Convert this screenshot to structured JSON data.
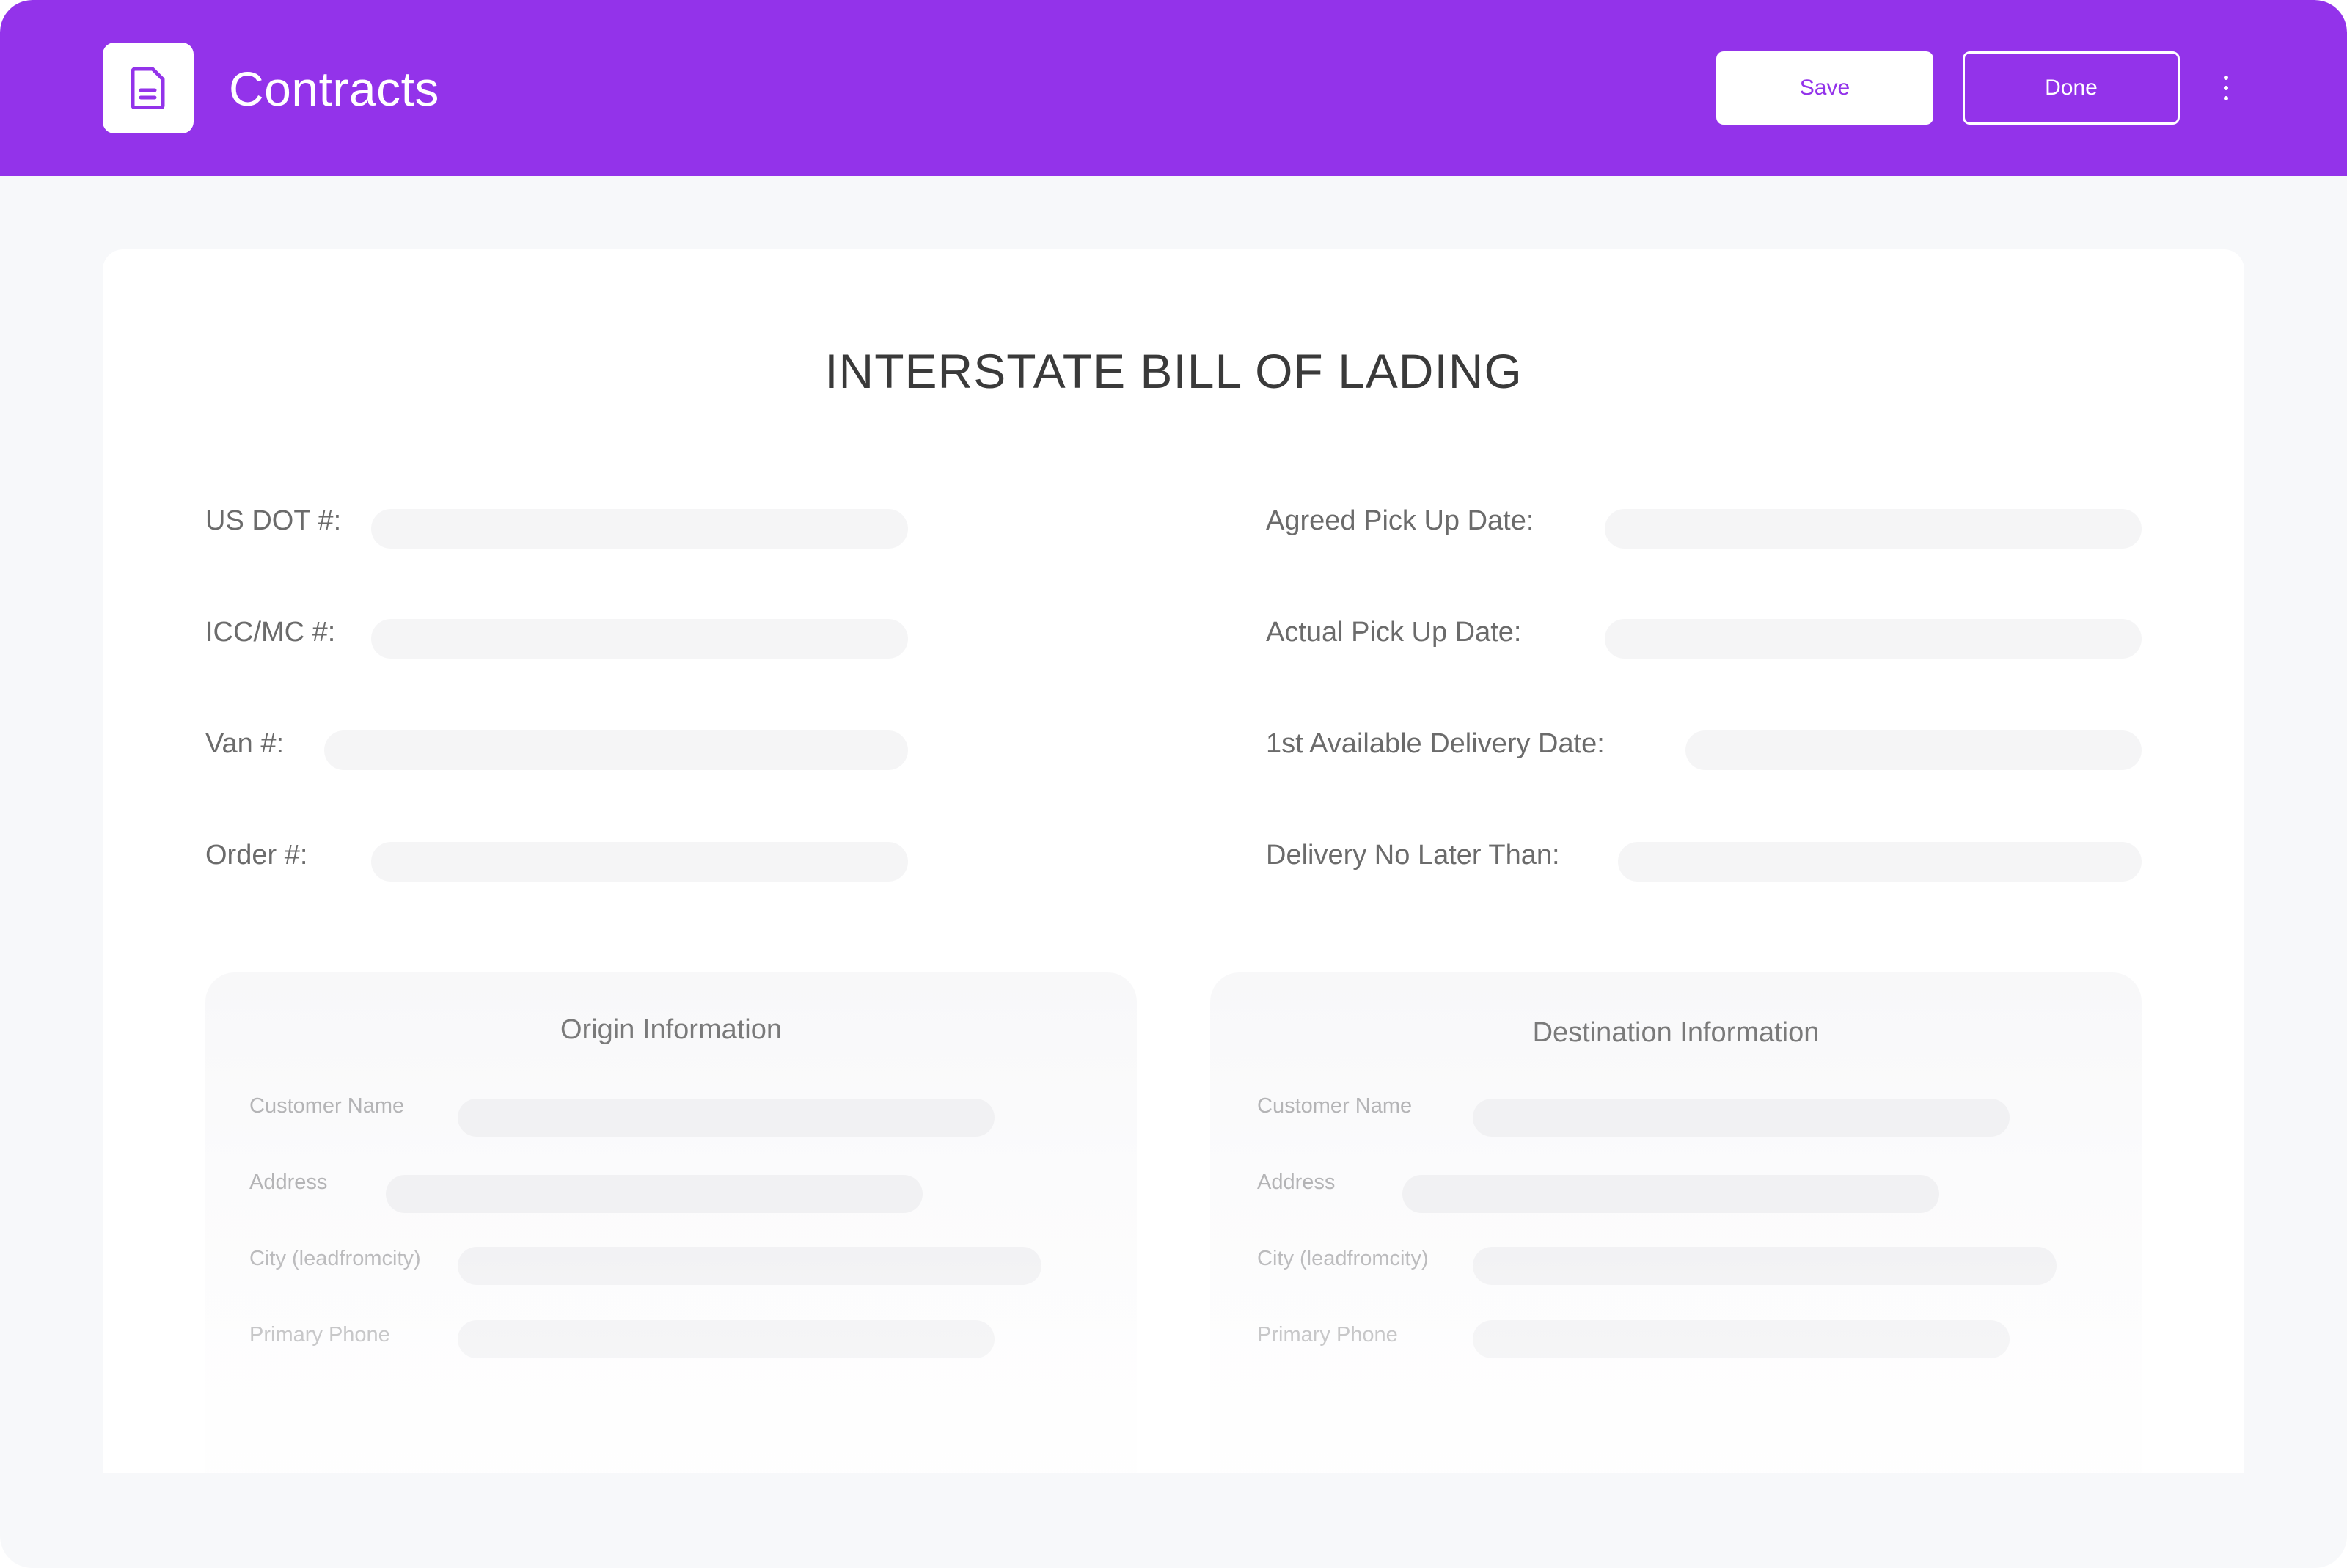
{
  "header": {
    "app_icon": "document-icon",
    "title": "Contracts",
    "save_label": "Save",
    "done_label": "Done",
    "more_icon": "more-vertical-icon"
  },
  "colors": {
    "brand": "#9333ea",
    "header_text": "#ffffff",
    "page_bg": "#f7f8fa",
    "input_bg": "#f5f5f6"
  },
  "document": {
    "title": "INTERSTATE BILL OF LADING",
    "left_fields": [
      {
        "label": "US DOT #:",
        "value": ""
      },
      {
        "label": "ICC/MC #:",
        "value": ""
      },
      {
        "label": "Van #:",
        "value": ""
      },
      {
        "label": "Order #:",
        "value": ""
      }
    ],
    "right_fields": [
      {
        "label": "Agreed Pick Up Date:",
        "value": ""
      },
      {
        "label": "Actual Pick Up Date:",
        "value": ""
      },
      {
        "label": "1st Available Delivery Date:",
        "value": ""
      },
      {
        "label": "Delivery No Later Than:",
        "value": ""
      }
    ]
  },
  "origin": {
    "title": "Origin Information",
    "fields": [
      {
        "label": "Customer Name",
        "value": ""
      },
      {
        "label": "Address",
        "value": ""
      },
      {
        "label": "City (leadfromcity)",
        "value": ""
      },
      {
        "label": "Primary Phone",
        "value": ""
      }
    ]
  },
  "destination": {
    "title": "Destination Information",
    "fields": [
      {
        "label": "Customer Name",
        "value": ""
      },
      {
        "label": "Address",
        "value": ""
      },
      {
        "label": "City (leadfromcity)",
        "value": ""
      },
      {
        "label": "Primary Phone",
        "value": ""
      }
    ]
  }
}
